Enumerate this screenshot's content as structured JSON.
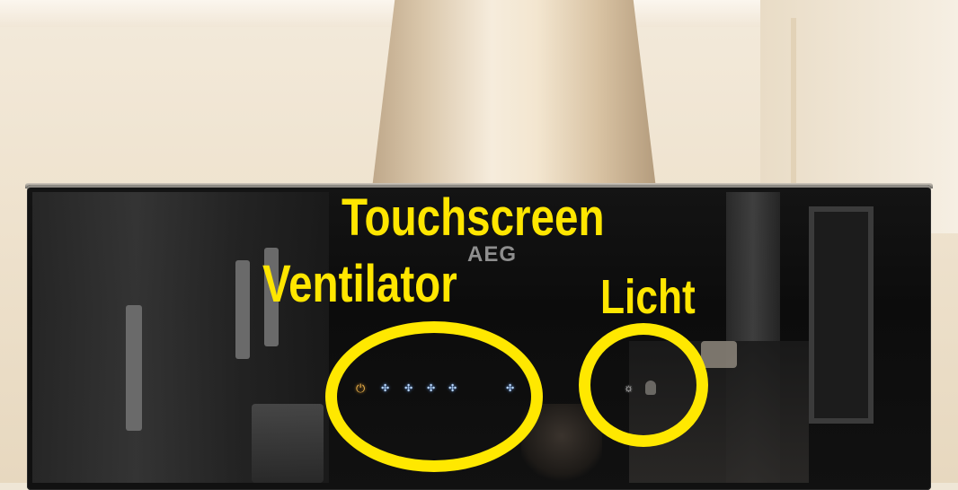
{
  "labels": {
    "touchscreen": "Touchscreen",
    "ventilator": "Ventilator",
    "licht": "Licht"
  },
  "brand": {
    "logo": "AEG"
  },
  "controls": {
    "power_icon": "power-icon",
    "fan_icons": [
      "fan-speed-1-icon",
      "fan-speed-2-icon",
      "fan-speed-3-icon",
      "fan-speed-4-icon"
    ],
    "boost_icon": "fan-boost-icon",
    "light_icon": "light-bulb-icon"
  },
  "colors": {
    "annotation": "#ffe600",
    "icon_glow": "#b8d8ff",
    "power": "#e8b04a"
  }
}
